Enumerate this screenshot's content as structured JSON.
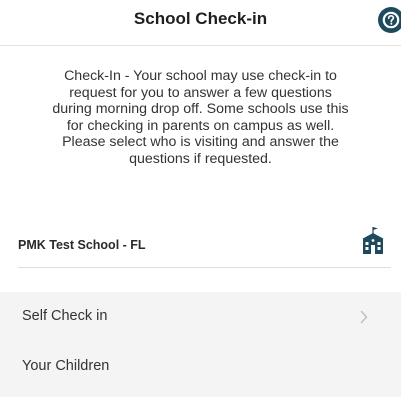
{
  "header": {
    "title": "School Check-in",
    "help_icon": "help-question-icon"
  },
  "description": {
    "line1": "Check-In - Your school may use check-in to",
    "line2": "request for you to answer a few questions",
    "line3": "during morning drop off. Some schools use this",
    "line4": "for checking in parents on campus as well.",
    "line5": "Please select who is visiting and answer the",
    "line6": "questions if requested."
  },
  "school": {
    "name": "PMK Test School - FL",
    "icon": "school-building-icon"
  },
  "options": [
    {
      "label": "Self Check in",
      "icon": "chevron-right-icon"
    },
    {
      "label": "Your Children"
    }
  ],
  "colors": {
    "help_button": "#1f4a5e",
    "divider": "#dedede",
    "card_background": "#f4f4f4",
    "chevron": "#bdbdbd"
  }
}
